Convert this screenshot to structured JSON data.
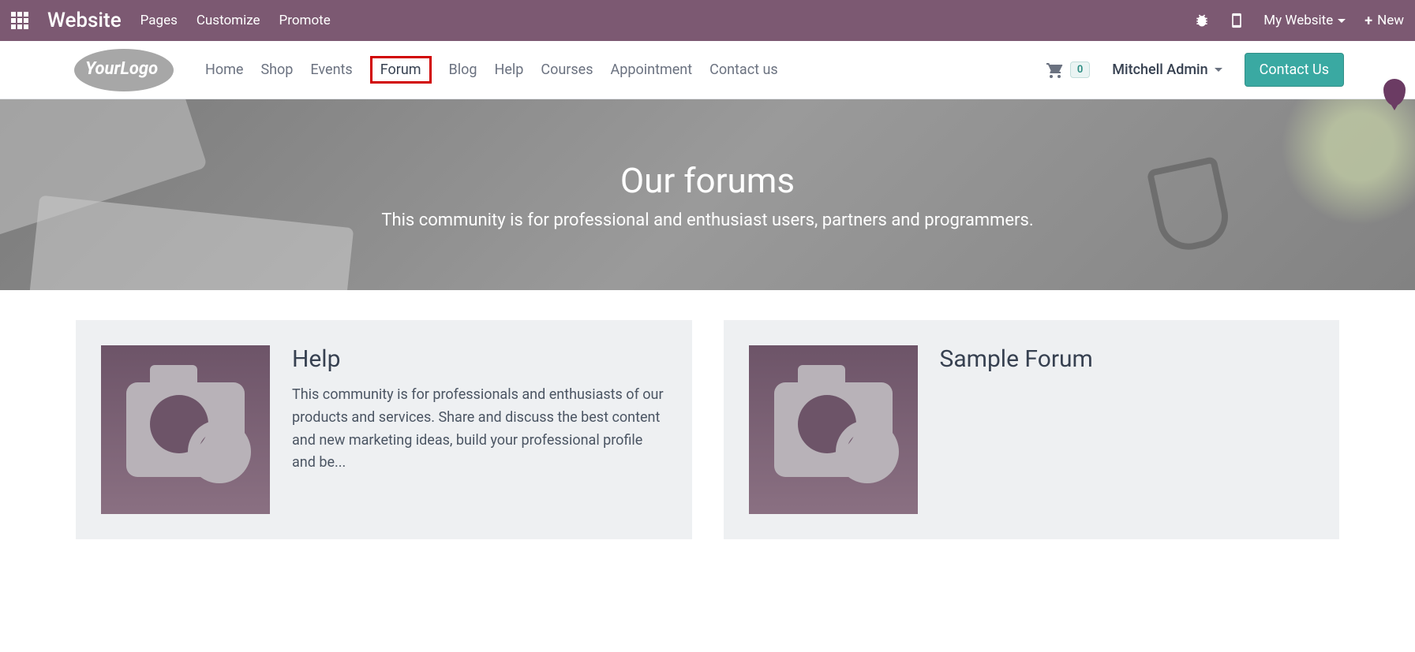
{
  "topbar": {
    "brand": "Website",
    "links": [
      "Pages",
      "Customize",
      "Promote"
    ],
    "my_website": "My Website",
    "new": "New"
  },
  "navbar": {
    "logo_text": "YourLogo",
    "items": [
      "Home",
      "Shop",
      "Events",
      "Forum",
      "Blog",
      "Help",
      "Courses",
      "Appointment",
      "Contact us"
    ],
    "cart_count": "0",
    "user": "Mitchell Admin",
    "contact_btn": "Contact Us"
  },
  "hero": {
    "title": "Our forums",
    "subtitle": "This community is for professional and enthusiast users, partners and programmers."
  },
  "cards": [
    {
      "title": "Help",
      "body": "This community is for professionals and enthusiasts of our products and services. Share and discuss the best content and new marketing ideas, build your professional profile and be..."
    },
    {
      "title": "Sample Forum",
      "body": ""
    }
  ]
}
